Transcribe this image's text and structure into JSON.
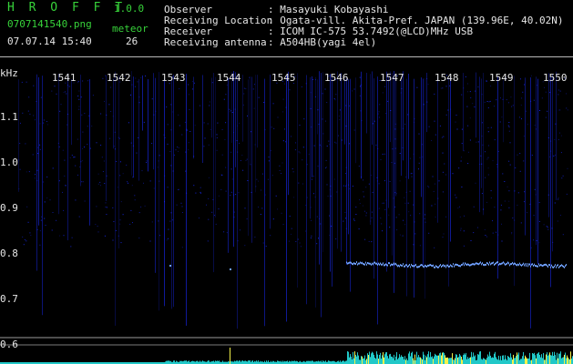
{
  "header": {
    "brand": "H R O F F T",
    "version": "1.0.0",
    "filename": "0707141540.png",
    "mode_label": "meteor",
    "datetime": "07.07.14 15:40",
    "count": "26",
    "info": [
      {
        "label": "Observer",
        "value": ": Masayuki Kobayashi"
      },
      {
        "label": "Receiving Location",
        "value": ": Ogata-vill. Akita-Pref. JAPAN (139.96E, 40.02N)"
      },
      {
        "label": "Receiver",
        "value": ": ICOM IC-575 53.7492(@LCD)MHz USB"
      },
      {
        "label": "Receiving antenna",
        "value": ": A504HB(yagi 4el)"
      }
    ]
  },
  "axis": {
    "unit": "kHz",
    "time_ticks": [
      "1541",
      "1542",
      "1543",
      "1544",
      "1545",
      "1546",
      "1547",
      "1548",
      "1549",
      "1550"
    ],
    "freq_ticks": [
      "1.1",
      "1.0",
      "0.9",
      "0.8",
      "0.7",
      "0.6"
    ]
  },
  "colors": {
    "brand": "#37d23a",
    "text": "#e6e6e6",
    "noise": "#1a2cff",
    "trace": "#6fa0ff",
    "bars": "#21c8c8",
    "spike": "#f4f24a"
  }
}
